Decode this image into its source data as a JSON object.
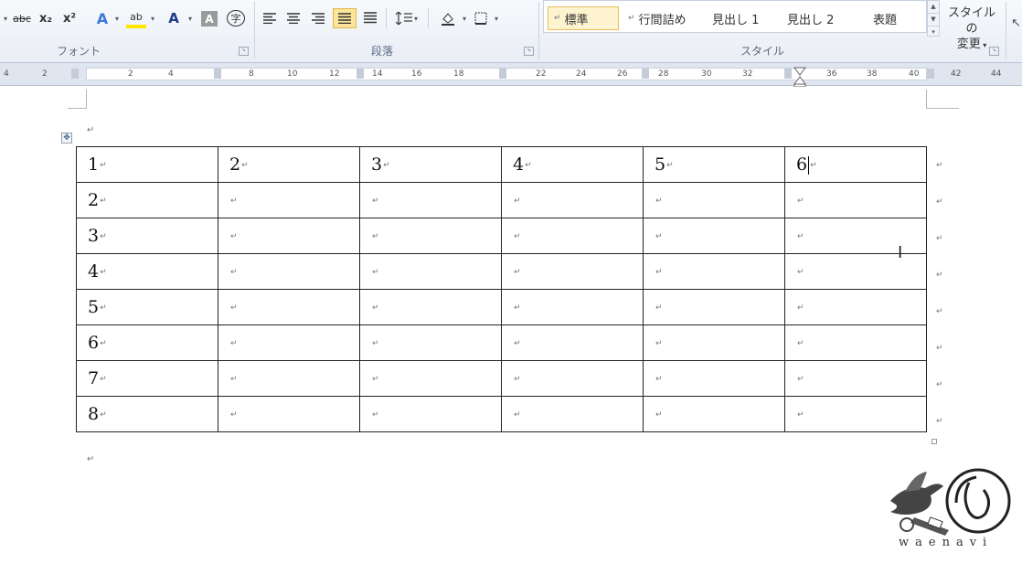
{
  "ribbon": {
    "font_group": {
      "label": "フォント",
      "buttons": {
        "strikethrough": "abc",
        "subscript": "x₂",
        "superscript": "x²",
        "text_effects": "A",
        "highlight": "ab",
        "font_color": "A",
        "char_shading": "A",
        "enclose_char": "字"
      }
    },
    "paragraph_group": {
      "label": "段落"
    },
    "styles_group": {
      "label": "スタイル",
      "items": [
        {
          "label": "標準",
          "selected": true
        },
        {
          "label": "行間詰め",
          "selected": false
        },
        {
          "label": "見出し 1",
          "selected": false
        },
        {
          "label": "見出し 2",
          "selected": false
        },
        {
          "label": "表題",
          "selected": false
        }
      ],
      "change_styles_line1": "スタイルの",
      "change_styles_line2": "変更"
    }
  },
  "ruler": {
    "labels": [
      "4",
      "2",
      "2",
      "4",
      "8",
      "10",
      "12",
      "14",
      "16",
      "18",
      "22",
      "24",
      "26",
      "28",
      "30",
      "32",
      "36",
      "38",
      "40",
      "42",
      "44"
    ]
  },
  "document": {
    "table": {
      "rows": [
        [
          "1",
          "2",
          "3",
          "4",
          "5",
          "6"
        ],
        [
          "2",
          "",
          "",
          "",
          "",
          ""
        ],
        [
          "3",
          "",
          "",
          "",
          "",
          ""
        ],
        [
          "4",
          "",
          "",
          "",
          "",
          ""
        ],
        [
          "5",
          "",
          "",
          "",
          "",
          ""
        ],
        [
          "6",
          "",
          "",
          "",
          "",
          ""
        ],
        [
          "7",
          "",
          "",
          "",
          "",
          ""
        ],
        [
          "8",
          "",
          "",
          "",
          "",
          ""
        ]
      ]
    }
  },
  "logo": {
    "text": "waenavi"
  },
  "colors": {
    "selected_bg": "#fbe59b",
    "ribbon_bg": "#eef2f7",
    "ruler_bg": "#dfe6ef"
  }
}
